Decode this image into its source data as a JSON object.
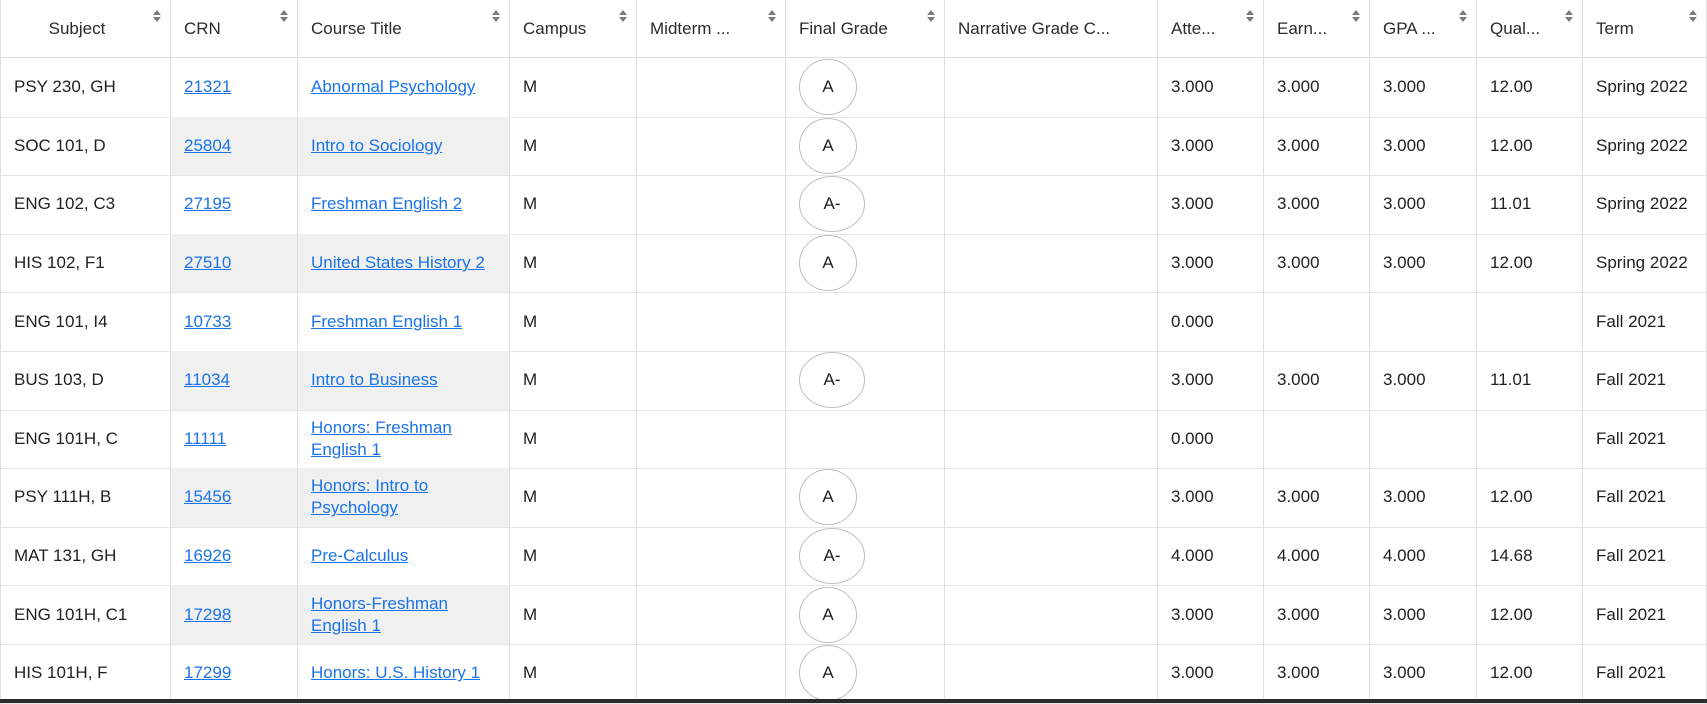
{
  "headers": [
    {
      "label": "Subject",
      "sortable": true
    },
    {
      "label": "CRN",
      "sortable": true
    },
    {
      "label": "Course Title",
      "sortable": true
    },
    {
      "label": "Campus",
      "sortable": true
    },
    {
      "label": "Midterm ...",
      "sortable": true
    },
    {
      "label": "Final Grade",
      "sortable": true
    },
    {
      "label": "Narrative Grade C...",
      "sortable": false
    },
    {
      "label": "Atte...",
      "sortable": true
    },
    {
      "label": "Earn...",
      "sortable": true
    },
    {
      "label": "GPA ...",
      "sortable": true
    },
    {
      "label": "Qual...",
      "sortable": true
    },
    {
      "label": "Term",
      "sortable": true
    }
  ],
  "rows": [
    {
      "subject": "PSY 230, GH",
      "crn": "21321",
      "title": "Abnormal Psychology",
      "campus": "M",
      "midterm": "",
      "final": "A",
      "narrative": "",
      "attempted": "3.000",
      "earned": "3.000",
      "gpa": "3.000",
      "quality": "12.00",
      "term": "Spring 2022"
    },
    {
      "subject": "SOC 101, D",
      "crn": "25804",
      "title": "Intro to Sociology",
      "campus": "M",
      "midterm": "",
      "final": "A",
      "narrative": "",
      "attempted": "3.000",
      "earned": "3.000",
      "gpa": "3.000",
      "quality": "12.00",
      "term": "Spring 2022"
    },
    {
      "subject": "ENG 102, C3",
      "crn": "27195",
      "title": "Freshman English 2",
      "campus": "M",
      "midterm": "",
      "final": "A-",
      "narrative": "",
      "attempted": "3.000",
      "earned": "3.000",
      "gpa": "3.000",
      "quality": "11.01",
      "term": "Spring 2022"
    },
    {
      "subject": "HIS 102, F1",
      "crn": "27510",
      "title": "United States History 2",
      "campus": "M",
      "midterm": "",
      "final": "A",
      "narrative": "",
      "attempted": "3.000",
      "earned": "3.000",
      "gpa": "3.000",
      "quality": "12.00",
      "term": "Spring 2022"
    },
    {
      "subject": "ENG 101, I4",
      "crn": "10733",
      "title": "Freshman English 1",
      "campus": "M",
      "midterm": "",
      "final": "",
      "narrative": "",
      "attempted": "0.000",
      "earned": "",
      "gpa": "",
      "quality": "",
      "term": "Fall 2021"
    },
    {
      "subject": "BUS 103, D",
      "crn": "11034",
      "title": "Intro to Business",
      "campus": "M",
      "midterm": "",
      "final": "A-",
      "narrative": "",
      "attempted": "3.000",
      "earned": "3.000",
      "gpa": "3.000",
      "quality": "11.01",
      "term": "Fall 2021"
    },
    {
      "subject": "ENG 101H, C",
      "crn": "11111",
      "title": "Honors: Freshman English 1",
      "campus": "M",
      "midterm": "",
      "final": "",
      "narrative": "",
      "attempted": "0.000",
      "earned": "",
      "gpa": "",
      "quality": "",
      "term": "Fall 2021"
    },
    {
      "subject": "PSY 111H, B",
      "crn": "15456",
      "title": "Honors: Intro to Psychology",
      "campus": "M",
      "midterm": "",
      "final": "A",
      "narrative": "",
      "attempted": "3.000",
      "earned": "3.000",
      "gpa": "3.000",
      "quality": "12.00",
      "term": "Fall 2021"
    },
    {
      "subject": "MAT 131, GH",
      "crn": "16926",
      "title": "Pre-Calculus",
      "campus": "M",
      "midterm": "",
      "final": "A-",
      "narrative": "",
      "attempted": "4.000",
      "earned": "4.000",
      "gpa": "4.000",
      "quality": "14.68",
      "term": "Fall 2021"
    },
    {
      "subject": "ENG 101H, C1",
      "crn": "17298",
      "title": "Honors-Freshman English 1",
      "campus": "M",
      "midterm": "",
      "final": "A",
      "narrative": "",
      "attempted": "3.000",
      "earned": "3.000",
      "gpa": "3.000",
      "quality": "12.00",
      "term": "Fall 2021"
    },
    {
      "subject": "HIS 101H, F",
      "crn": "17299",
      "title": "Honors: U.S. History 1",
      "campus": "M",
      "midterm": "",
      "final": "A",
      "narrative": "",
      "attempted": "3.000",
      "earned": "3.000",
      "gpa": "3.000",
      "quality": "12.00",
      "term": "Fall 2021"
    }
  ],
  "colors": {
    "link": "#1a73e8",
    "shade": "#f0f0f0",
    "border": "#e0e0e0"
  },
  "icons": {
    "sort": "sort-arrows-icon"
  }
}
